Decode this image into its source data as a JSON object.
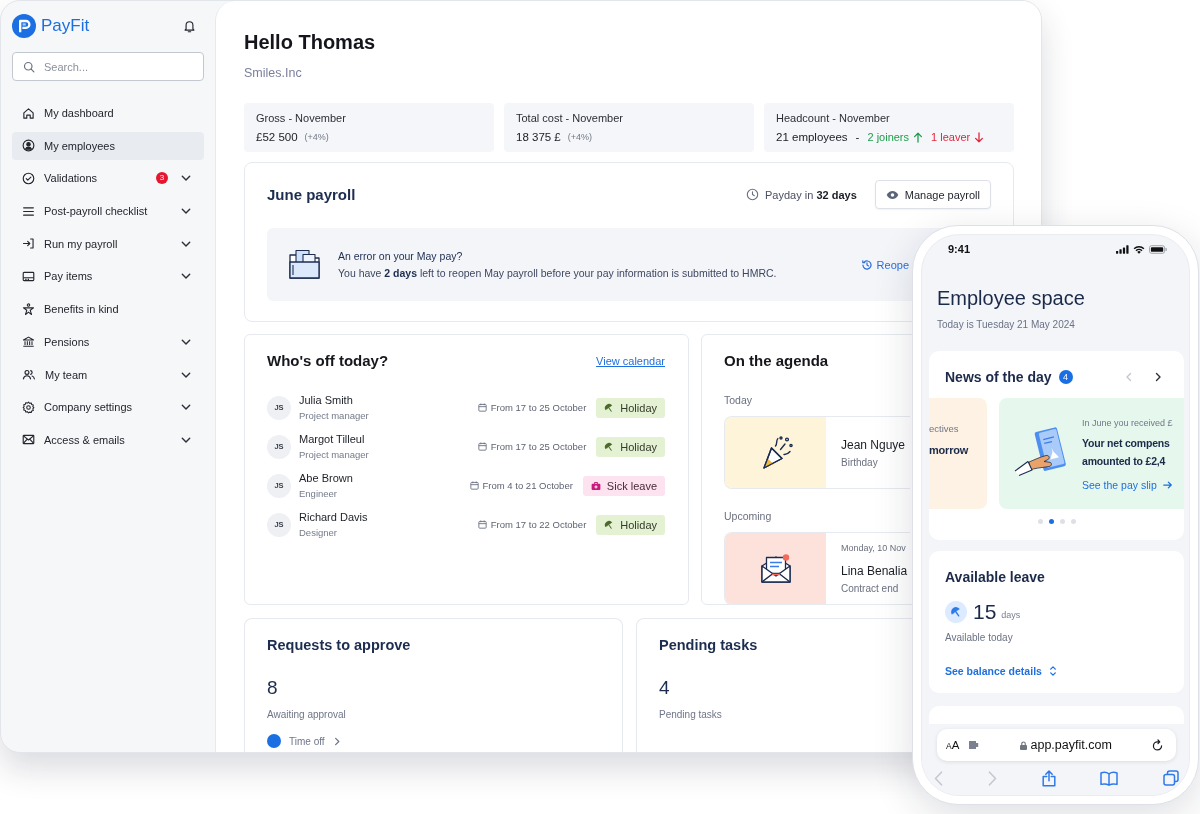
{
  "sidebar": {
    "brand": "PayFit",
    "search": {
      "placeholder": "Search..."
    },
    "items": [
      {
        "label": "My dashboard",
        "selected": false,
        "expandable": false
      },
      {
        "label": "My employees",
        "selected": true,
        "expandable": false
      },
      {
        "label": "Validations",
        "selected": false,
        "expandable": true,
        "badge": "3"
      },
      {
        "label": "Post-payroll checklist",
        "selected": false,
        "expandable": true
      },
      {
        "label": "Run my payroll",
        "selected": false,
        "expandable": true
      },
      {
        "label": "Pay items",
        "selected": false,
        "expandable": true
      },
      {
        "label": "Benefits in kind",
        "selected": false,
        "expandable": false
      },
      {
        "label": "Pensions",
        "selected": false,
        "expandable": true
      },
      {
        "label": "My team",
        "selected": false,
        "expandable": true
      },
      {
        "label": "Company settings",
        "selected": false,
        "expandable": true
      },
      {
        "label": "Access & emails",
        "selected": false,
        "expandable": true
      }
    ]
  },
  "header": {
    "greeting": "Hello Thomas",
    "company": "Smiles.Inc"
  },
  "stats": [
    {
      "kind": "change",
      "label": "Gross - November",
      "value": "£52 500",
      "change": "(+4%)"
    },
    {
      "kind": "change",
      "label": "Total cost - November",
      "value": "18 375 £",
      "change": "(+4%)"
    },
    {
      "kind": "headcount",
      "label": "Headcount - November",
      "value": "21 employees",
      "separator": "-",
      "joiners": "2 joiners",
      "leavers": "1 leaver"
    }
  ],
  "payroll": {
    "title": "June payroll",
    "payday": "Payday in **32 days**",
    "button": "Manage payroll",
    "alert": {
      "title": "An error on your May pay?",
      "message": "You have **2 days** left to reopen May payroll before your pay information is submitted to HMRC.",
      "action": "Reope"
    }
  },
  "whos_off": {
    "title": "Who's off today?",
    "link": "View calendar",
    "people": [
      {
        "initials": "JS",
        "name": "Julia Smith",
        "role": "Project manager",
        "dates": "From 17 to 25 October",
        "kind": "holiday",
        "status": "Holiday"
      },
      {
        "initials": "JS",
        "name": "Margot Tilleul",
        "role": "Project manager",
        "dates": "From 17 to 25 October",
        "kind": "holiday",
        "status": "Holiday"
      },
      {
        "initials": "JS",
        "name": "Abe Brown",
        "role": "Engineer",
        "dates": "From 4 to 21 October",
        "kind": "sick",
        "status": "Sick leave"
      },
      {
        "initials": "JS",
        "name": "Richard Davis",
        "role": "Designer",
        "dates": "From 17 to 22 October",
        "kind": "holiday",
        "status": "Holiday"
      }
    ]
  },
  "agenda": {
    "title": "On the agenda",
    "sections": [
      {
        "heading": "Today",
        "events": [
          {
            "kind": "birthday",
            "name": "Jean Nguye",
            "type": "Birthday"
          }
        ]
      },
      {
        "heading": "Upcoming",
        "events": [
          {
            "kind": "contract",
            "date": "Monday, 10 Nov",
            "name": "Lina Benalia",
            "type": "Contract end"
          }
        ]
      }
    ]
  },
  "summary": [
    {
      "title": "Requests to approve",
      "count": "8",
      "caption": "Awaiting approval",
      "link": "Time off"
    },
    {
      "title": "Pending tasks",
      "count": "4",
      "caption": "Pending tasks"
    }
  ],
  "phone": {
    "time": "9:41",
    "title": "Employee space",
    "date": "Today is Tuesday 21 May 2024",
    "news": {
      "title": "News of the day",
      "count": "4",
      "arrows": [
        {
          "disabled": true
        },
        {
          "disabled": false
        }
      ],
      "slides": [
        {
          "kind": "reminder",
          "caption": "ectives",
          "lines": [
            "morrow"
          ]
        },
        {
          "kind": "payslip",
          "caption": "In June you received £",
          "lines": [
            "Your net compens",
            "amounted to £2,4"
          ],
          "link": "See the pay slip"
        }
      ],
      "dots": [
        {
          "selected": false
        },
        {
          "selected": true
        },
        {
          "selected": false
        },
        {
          "selected": false
        }
      ]
    },
    "leave": {
      "title": "Available leave",
      "value": "15",
      "unit": "days",
      "caption": "Available today",
      "link": "See balance details"
    },
    "browser": {
      "text_size": "AA",
      "url": "app.payfit.com",
      "toolbar": [
        {
          "disabled": true
        },
        {
          "disabled": true
        },
        {
          "disabled": false
        },
        {
          "disabled": false
        },
        {
          "disabled": false
        }
      ]
    }
  }
}
